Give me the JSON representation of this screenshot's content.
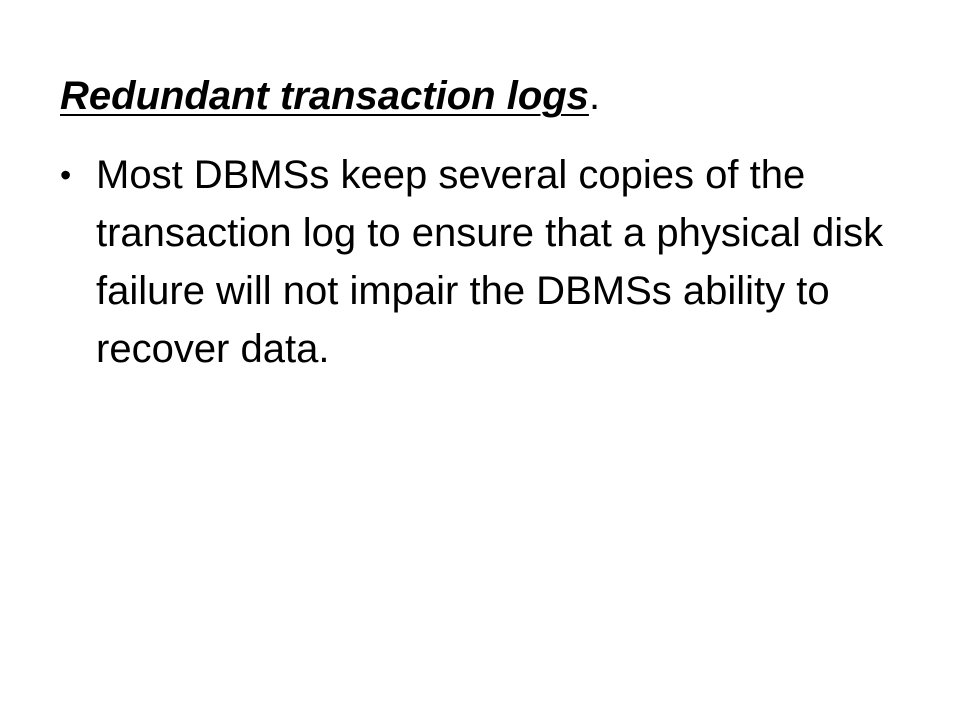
{
  "slide": {
    "heading": {
      "text": "Redundant transaction logs",
      "punctuation": "."
    },
    "bullets": [
      {
        "marker": "•",
        "text": "Most DBMSs keep several copies of the transaction log to ensure that a physical disk failure will not impair the DBMSs ability to recover data."
      }
    ]
  }
}
